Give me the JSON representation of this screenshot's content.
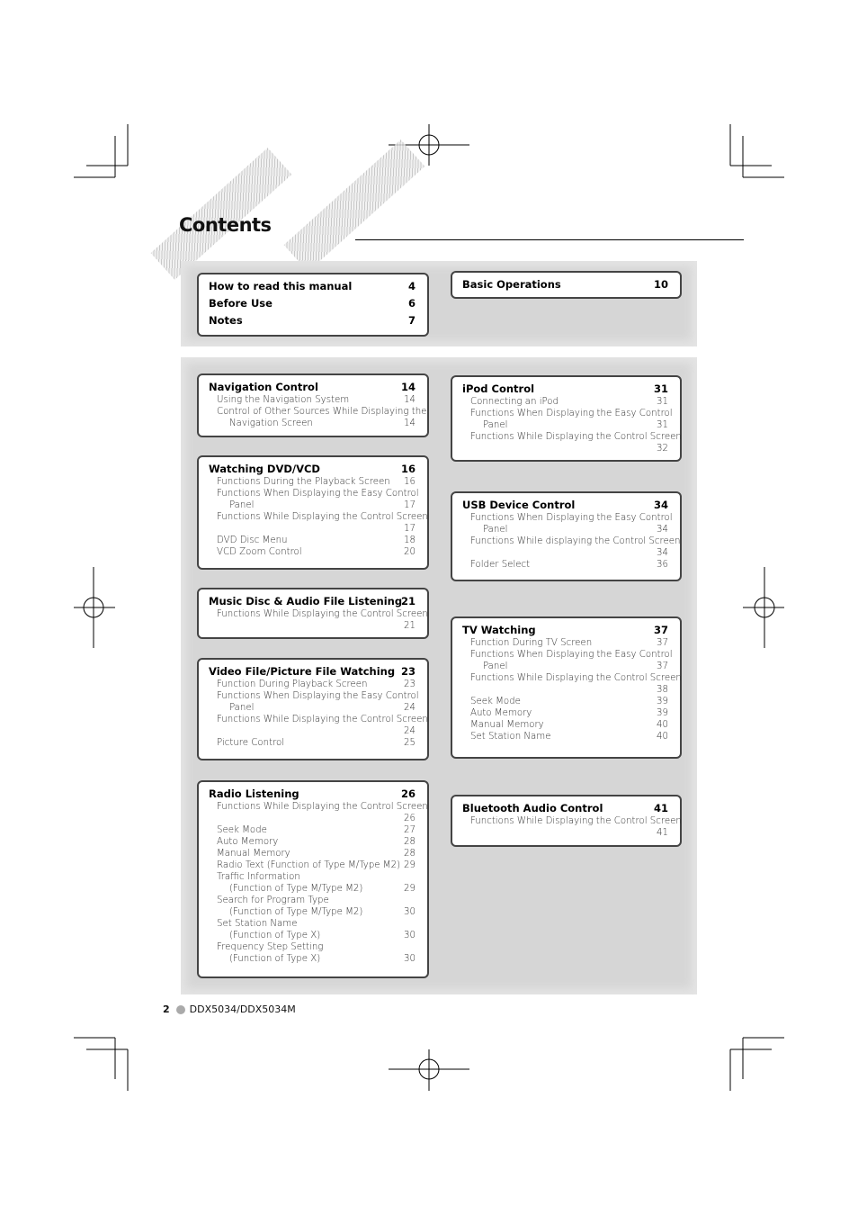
{
  "heading": "Contents",
  "footer": {
    "page_number": "2",
    "model": "DDX5034/DDX5034M"
  },
  "sections": [
    {
      "stack": true,
      "titles": [
        {
          "t": "How to read this manual",
          "p": "4"
        },
        {
          "t": "Before Use",
          "p": "6"
        },
        {
          "t": "Notes",
          "p": "7"
        }
      ],
      "rows": []
    },
    {
      "stack": true,
      "titles": [
        {
          "t": "Basic Operations",
          "p": "10"
        }
      ],
      "rows": []
    },
    {
      "titles": [
        {
          "t": "Navigation Control",
          "p": "14"
        }
      ],
      "rows": [
        {
          "t": "Using the Navigation System",
          "p": "14"
        },
        {
          "t": "Control of Other Sources While Displaying the",
          "p": ""
        },
        {
          "t": "Navigation Screen",
          "p": "14",
          "i": true
        }
      ]
    },
    {
      "titles": [
        {
          "t": "Watching DVD/VCD",
          "p": "16"
        }
      ],
      "rows": [
        {
          "t": "Functions During the Playback Screen",
          "p": "16"
        },
        {
          "t": "Functions When Displaying the Easy Control",
          "p": ""
        },
        {
          "t": "Panel",
          "p": "17",
          "i": true
        },
        {
          "t": "Functions While Displaying the Control Screen",
          "p": ""
        },
        {
          "t": "",
          "p": "17"
        },
        {
          "t": "DVD Disc Menu",
          "p": "18"
        },
        {
          "t": "VCD Zoom Control",
          "p": "20"
        }
      ]
    },
    {
      "titles": [
        {
          "t": "Music Disc & Audio File Listening",
          "p": "21"
        }
      ],
      "rows": [
        {
          "t": "Functions While Displaying the Control Screen",
          "p": ""
        },
        {
          "t": "",
          "p": "21"
        }
      ]
    },
    {
      "titles": [
        {
          "t": "Video File/Picture File Watching",
          "p": "23"
        }
      ],
      "rows": [
        {
          "t": "Function During Playback Screen",
          "p": "23"
        },
        {
          "t": "Functions When Displaying the Easy Control",
          "p": ""
        },
        {
          "t": "Panel",
          "p": "24",
          "i": true
        },
        {
          "t": "Functions While Displaying the Control Screen",
          "p": ""
        },
        {
          "t": "",
          "p": "24"
        },
        {
          "t": "Picture Control",
          "p": "25"
        }
      ]
    },
    {
      "titles": [
        {
          "t": "Radio Listening",
          "p": "26"
        }
      ],
      "rows": [
        {
          "t": "Functions While Displaying the Control Screen",
          "p": ""
        },
        {
          "t": "",
          "p": "26"
        },
        {
          "t": "Seek Mode",
          "p": "27"
        },
        {
          "t": "Auto Memory",
          "p": "28"
        },
        {
          "t": "Manual Memory",
          "p": "28"
        },
        {
          "t": "Radio Text (Function of Type M/Type M2)",
          "p": "29"
        },
        {
          "t": "Traffic Information",
          "p": ""
        },
        {
          "t": "(Function of Type M/Type M2)",
          "p": "29",
          "i": true
        },
        {
          "t": "Search for Program Type",
          "p": ""
        },
        {
          "t": "(Function of Type M/Type M2)",
          "p": "30",
          "i": true
        },
        {
          "t": "Set Station Name",
          "p": ""
        },
        {
          "t": "(Function of Type X)",
          "p": "30",
          "i": true
        },
        {
          "t": "Frequency Step Setting",
          "p": ""
        },
        {
          "t": "(Function of Type X)",
          "p": "30",
          "i": true
        }
      ]
    },
    {
      "titles": [
        {
          "t": "iPod Control",
          "p": "31"
        }
      ],
      "rows": [
        {
          "t": "Connecting an iPod",
          "p": "31"
        },
        {
          "t": "Functions When Displaying the Easy Control",
          "p": ""
        },
        {
          "t": "Panel",
          "p": "31",
          "i": true
        },
        {
          "t": "Functions While Displaying the Control Screen",
          "p": ""
        },
        {
          "t": "",
          "p": "32"
        }
      ]
    },
    {
      "titles": [
        {
          "t": "USB Device Control",
          "p": "34"
        }
      ],
      "rows": [
        {
          "t": "Functions When Displaying the Easy Control",
          "p": ""
        },
        {
          "t": "Panel",
          "p": "34",
          "i": true
        },
        {
          "t": "Functions While displaying the Control Screen",
          "p": ""
        },
        {
          "t": "",
          "p": "34"
        },
        {
          "t": "Folder Select",
          "p": "36"
        }
      ]
    },
    {
      "titles": [
        {
          "t": "TV Watching",
          "p": "37"
        }
      ],
      "rows": [
        {
          "t": "Function During TV Screen",
          "p": "37"
        },
        {
          "t": "Functions When Displaying the Easy Control",
          "p": ""
        },
        {
          "t": "Panel",
          "p": "37",
          "i": true
        },
        {
          "t": "Functions While Displaying the Control Screen",
          "p": ""
        },
        {
          "t": "",
          "p": "38"
        },
        {
          "t": "Seek Mode",
          "p": "39"
        },
        {
          "t": "Auto Memory",
          "p": "39"
        },
        {
          "t": "Manual Memory",
          "p": "40"
        },
        {
          "t": "Set Station Name",
          "p": "40"
        }
      ]
    },
    {
      "titles": [
        {
          "t": "Bluetooth Audio Control",
          "p": "41"
        }
      ],
      "rows": [
        {
          "t": "Functions While Displaying the Control Screen",
          "p": ""
        },
        {
          "t": "",
          "p": "41"
        }
      ]
    }
  ]
}
